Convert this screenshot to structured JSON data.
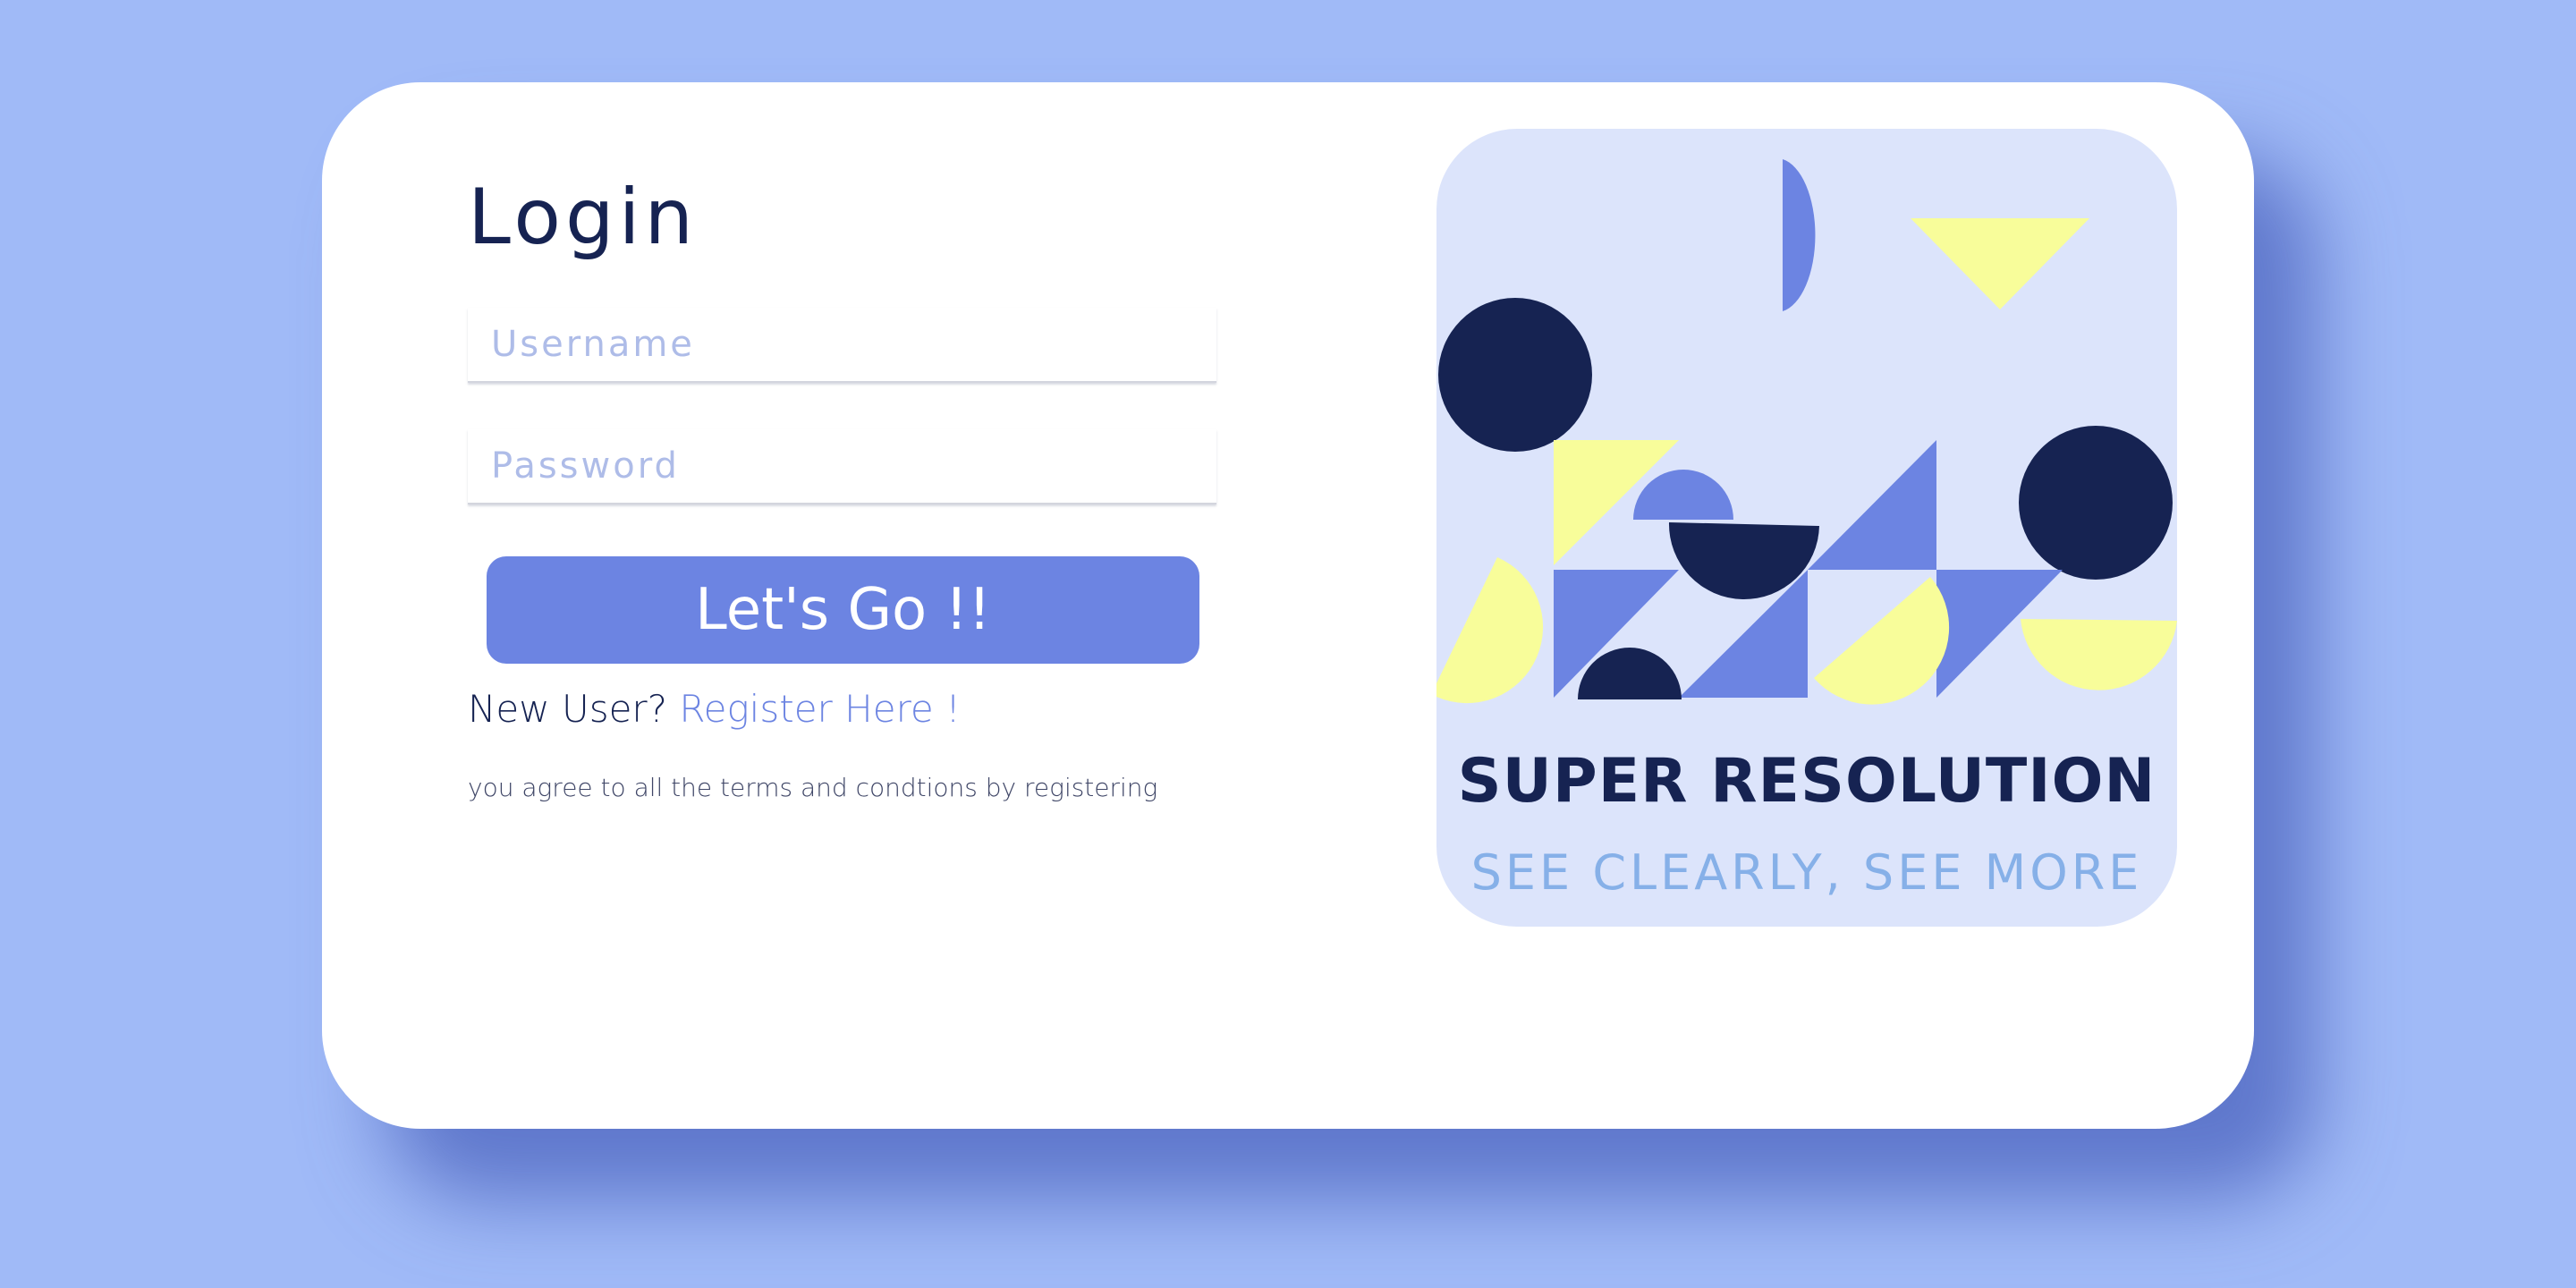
{
  "login": {
    "title": "Login",
    "username_placeholder": "Username",
    "password_placeholder": "Password",
    "submit_label": "Let's Go !!",
    "new_user_prompt": "New User? ",
    "register_link": "Register Here !",
    "terms_note": "you agree to all the terms and condtions by registering"
  },
  "brand": {
    "title": "SUPER RESOLUTION",
    "tagline": "SEE CLEARLY, SEE MORE"
  },
  "colors": {
    "background": "#a0baf7",
    "card": "#ffffff",
    "accent": "#6c84e2",
    "navy": "#162352",
    "yellow": "#f8fd9a",
    "panel": "#dce4fb",
    "tagline": "#86b0e8"
  },
  "illustration": {
    "motif": "geometric-shapes-pattern"
  }
}
